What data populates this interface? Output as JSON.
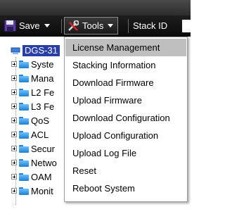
{
  "toolbar": {
    "save_label": "Save",
    "tools_label": "Tools",
    "stack_id_label": "Stack ID"
  },
  "tree": {
    "root_label": "DGS-31",
    "nodes": [
      {
        "label": "Syste"
      },
      {
        "label": "Mana"
      },
      {
        "label": "L2 Fe"
      },
      {
        "label": "L3 Fe"
      },
      {
        "label": "QoS"
      },
      {
        "label": "ACL"
      },
      {
        "label": "Secur"
      },
      {
        "label": "Netwo"
      },
      {
        "label": "OAM"
      },
      {
        "label": "Monit"
      }
    ]
  },
  "tools_menu": {
    "highlighted_index": 0,
    "items": [
      {
        "label": "License Management"
      },
      {
        "label": "Stacking Information"
      },
      {
        "label": "Download Firmware"
      },
      {
        "label": "Upload Firmware"
      },
      {
        "label": "Download Configuration"
      },
      {
        "label": "Upload Configuration"
      },
      {
        "label": "Upload Log File"
      },
      {
        "label": "Reset"
      },
      {
        "label": "Reboot System"
      }
    ]
  },
  "colors": {
    "toolbar_bg": "#111111",
    "root_highlight": "#2a3fa6",
    "menu_highlight": "#bfbfbf",
    "folder_blue": "#3a9be8"
  }
}
